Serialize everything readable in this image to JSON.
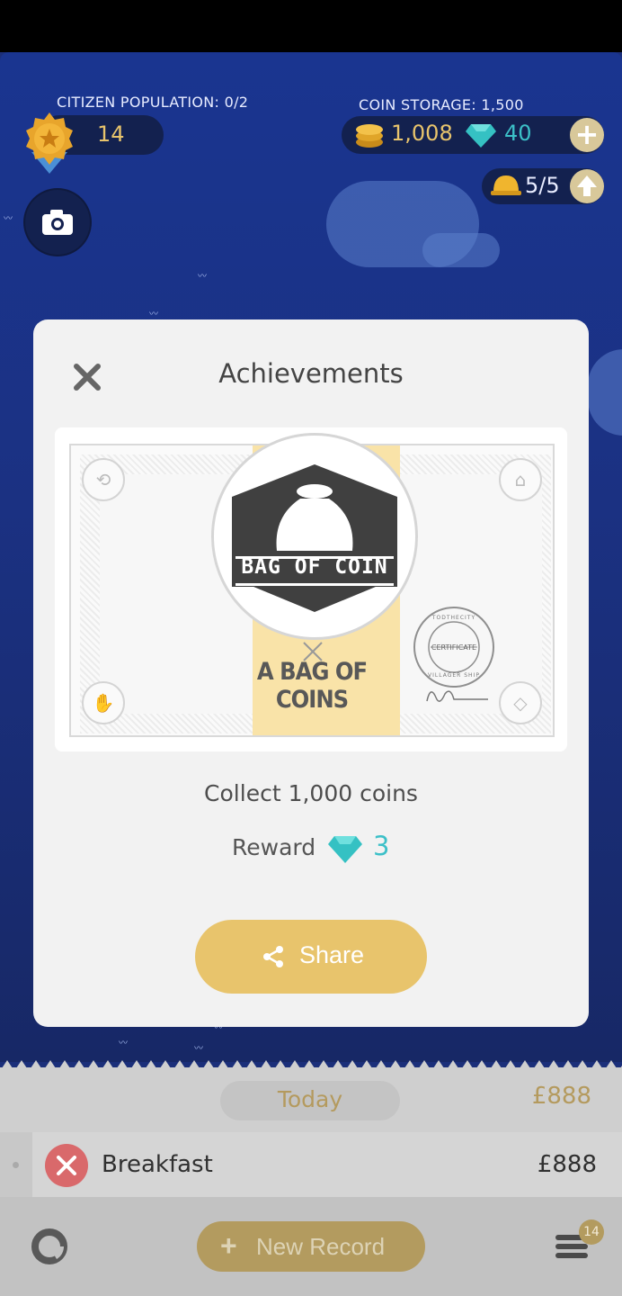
{
  "hud": {
    "population_label": "CITIZEN POPULATION: 0/2",
    "level": "14",
    "storage_label": "COIN STORAGE: 1,500",
    "coins": "1,008",
    "gems": "40",
    "builders": "5/5"
  },
  "modal": {
    "title": "Achievements",
    "medal_text": "BAG OF COIN",
    "certificate_name": "A BAG OF COINS",
    "stamp_top": "TODTHECITY",
    "stamp_mid": "CERTIFICATE",
    "stamp_bottom": "VILLAGER SHIP",
    "description": "Collect 1,000 coins",
    "reward_label": "Reward",
    "reward_value": "3",
    "share_label": "Share"
  },
  "records": {
    "date_label": "Today",
    "day_total": "£888",
    "items": [
      {
        "label": "Breakfast",
        "amount": "£888"
      }
    ],
    "new_record_label": "New Record",
    "menu_badge": "14"
  },
  "colors": {
    "accent_gold": "#e8c46c",
    "gem_teal": "#3cc0c8",
    "game_blue": "#1b3182"
  },
  "icons": [
    "star-badge-icon",
    "camera-icon",
    "coin-icon",
    "gem-icon",
    "plus-icon",
    "helmet-icon",
    "upgrade-arrow-icon",
    "close-icon",
    "share-icon",
    "fork-knife-icon",
    "pie-chart-icon",
    "menu-icon"
  ]
}
